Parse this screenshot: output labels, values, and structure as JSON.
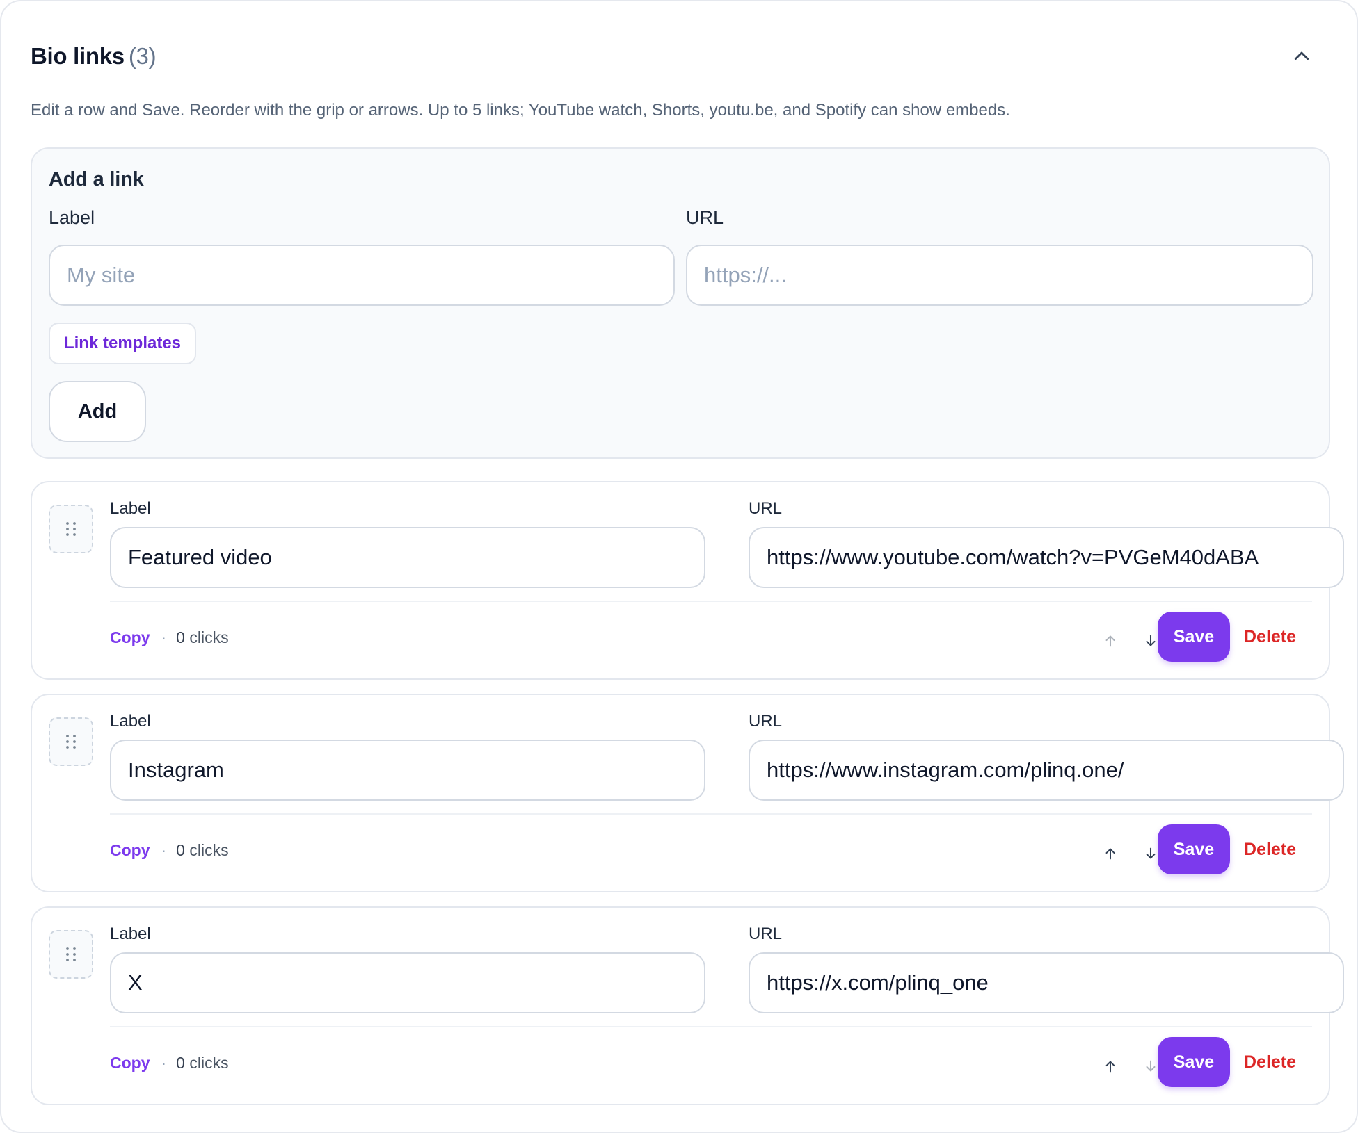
{
  "header": {
    "title": "Bio links",
    "count": "(3)",
    "collapse_icon": "chevron-up-icon"
  },
  "description": "Edit a row and Save. Reorder with the grip or arrows. Up to 5 links; YouTube watch, Shorts, youtu.be, and Spotify can show embeds.",
  "add_form": {
    "title": "Add a link",
    "label_field": {
      "label": "Label",
      "placeholder": "My site",
      "value": ""
    },
    "url_field": {
      "label": "URL",
      "placeholder": "https://...",
      "value": ""
    },
    "templates_button": "Link templates",
    "add_button": "Add"
  },
  "links": [
    {
      "label_caption": "Label",
      "label": "Featured video",
      "url_caption": "URL",
      "url": "https://www.youtube.com/watch?v=PVGeM40dABA",
      "copy": "Copy",
      "clicks_count": "0",
      "clicks_text": "clicks",
      "up_disabled": true,
      "down_disabled": false,
      "save": "Save",
      "delete": "Delete"
    },
    {
      "label_caption": "Label",
      "label": "Instagram",
      "url_caption": "URL",
      "url": "https://www.instagram.com/plinq.one/",
      "copy": "Copy",
      "clicks_count": "0",
      "clicks_text": "clicks",
      "up_disabled": false,
      "down_disabled": false,
      "save": "Save",
      "delete": "Delete"
    },
    {
      "label_caption": "Label",
      "label": "X",
      "url_caption": "URL",
      "url": "https://x.com/plinq_one",
      "copy": "Copy",
      "clicks_count": "0",
      "clicks_text": "clicks",
      "up_disabled": false,
      "down_disabled": true,
      "save": "Save",
      "delete": "Delete"
    }
  ],
  "colors": {
    "accent": "#7c3aed",
    "danger": "#dc2626",
    "muted_text": "#64748b",
    "border": "#e3e7ee"
  }
}
